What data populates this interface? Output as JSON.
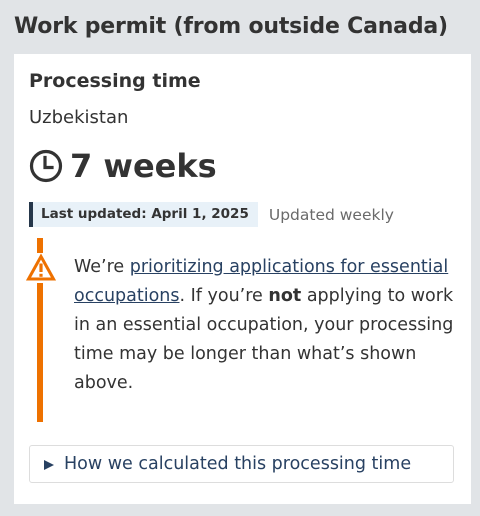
{
  "page": {
    "title": "Work permit (from outside Canada)"
  },
  "card": {
    "heading": "Processing time",
    "country": "Uzbekistan",
    "processing_time": "7 weeks",
    "last_updated": "Last updated: April 1, 2025",
    "update_frequency": "Updated weekly",
    "alert": {
      "prefix": "We’re ",
      "link_text": "prioritizing applications for essential occupations",
      "middle": ". If you’re ",
      "strong": "not",
      "suffix": " applying to work in an essential occupation, your processing time may be longer than what’s shown above."
    },
    "details_label": "How we calculated this processing time"
  },
  "icons": {
    "clock": "clock-icon",
    "warning": "warning-icon",
    "expand": "triangle-right-icon"
  },
  "colors": {
    "background": "#e1e4e7",
    "card": "#ffffff",
    "text": "#333333",
    "link": "#284162",
    "alert_accent": "#ee7100",
    "updated_bg": "#e8f1f8",
    "updated_border": "#26374a"
  }
}
